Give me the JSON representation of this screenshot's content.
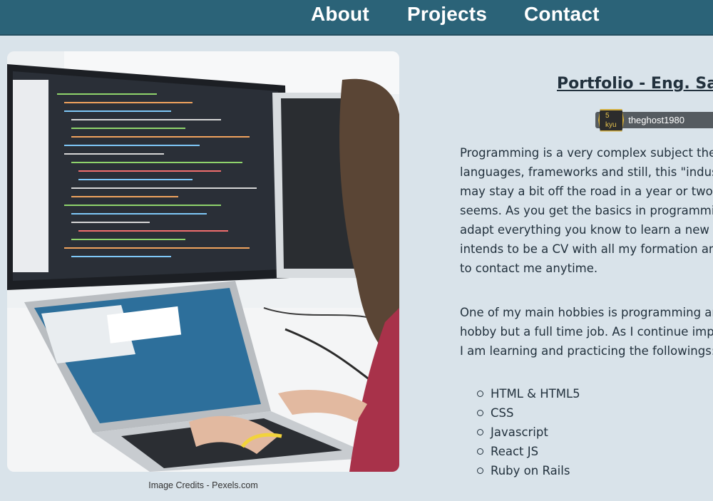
{
  "nav": {
    "items": [
      "About",
      "Projects",
      "Contact"
    ]
  },
  "photo": {
    "caption": "Image Credits - Pexels.com"
  },
  "content": {
    "title": "Portfolio - Eng. Satu",
    "badge": {
      "rank": "5 kyu",
      "username": "theghost1980"
    },
    "paragraph1": [
      "Programming is a very complex subject these",
      "languages, frameworks and still, this \"indust",
      "may stay a bit off the road in a year or two. E",
      "seems. As you get the basics in programming",
      "adapt everything you know to learn a new la",
      "intends to be a CV with all my formation and",
      "to contact me anytime."
    ],
    "paragraph2": [
      "One of my main hobbies is programming an",
      "hobby but a full time job. As I continue improv",
      "I am learning and practicing the followings:"
    ],
    "skills": [
      "HTML & HTML5",
      "CSS",
      "Javascript",
      "React JS",
      "Ruby on Rails"
    ]
  }
}
